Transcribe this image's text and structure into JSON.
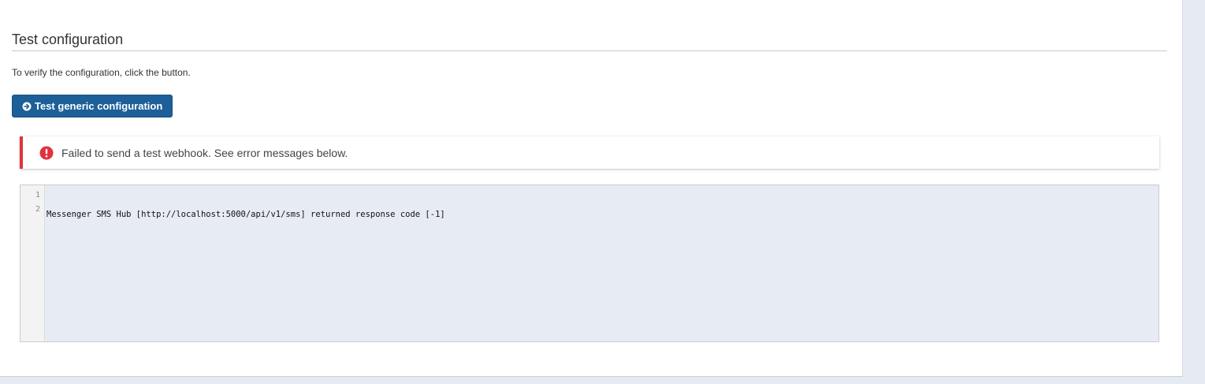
{
  "section": {
    "title": "Test configuration",
    "help_text": "To verify the configuration, click the button."
  },
  "test_button": {
    "label": "Test generic configuration",
    "icon": "arrow-circle-right-icon",
    "color": "#1d5f98"
  },
  "alert": {
    "icon": "exclamation-circle-icon",
    "message": "Failed to send a test webhook. See error messages below.",
    "color": "#e0333f"
  },
  "log": {
    "line_numbers": [
      "1",
      "2"
    ],
    "lines": [
      "Messenger SMS Hub [http://localhost:5000/api/v1/sms] returned response code [-1]",
      ""
    ]
  }
}
